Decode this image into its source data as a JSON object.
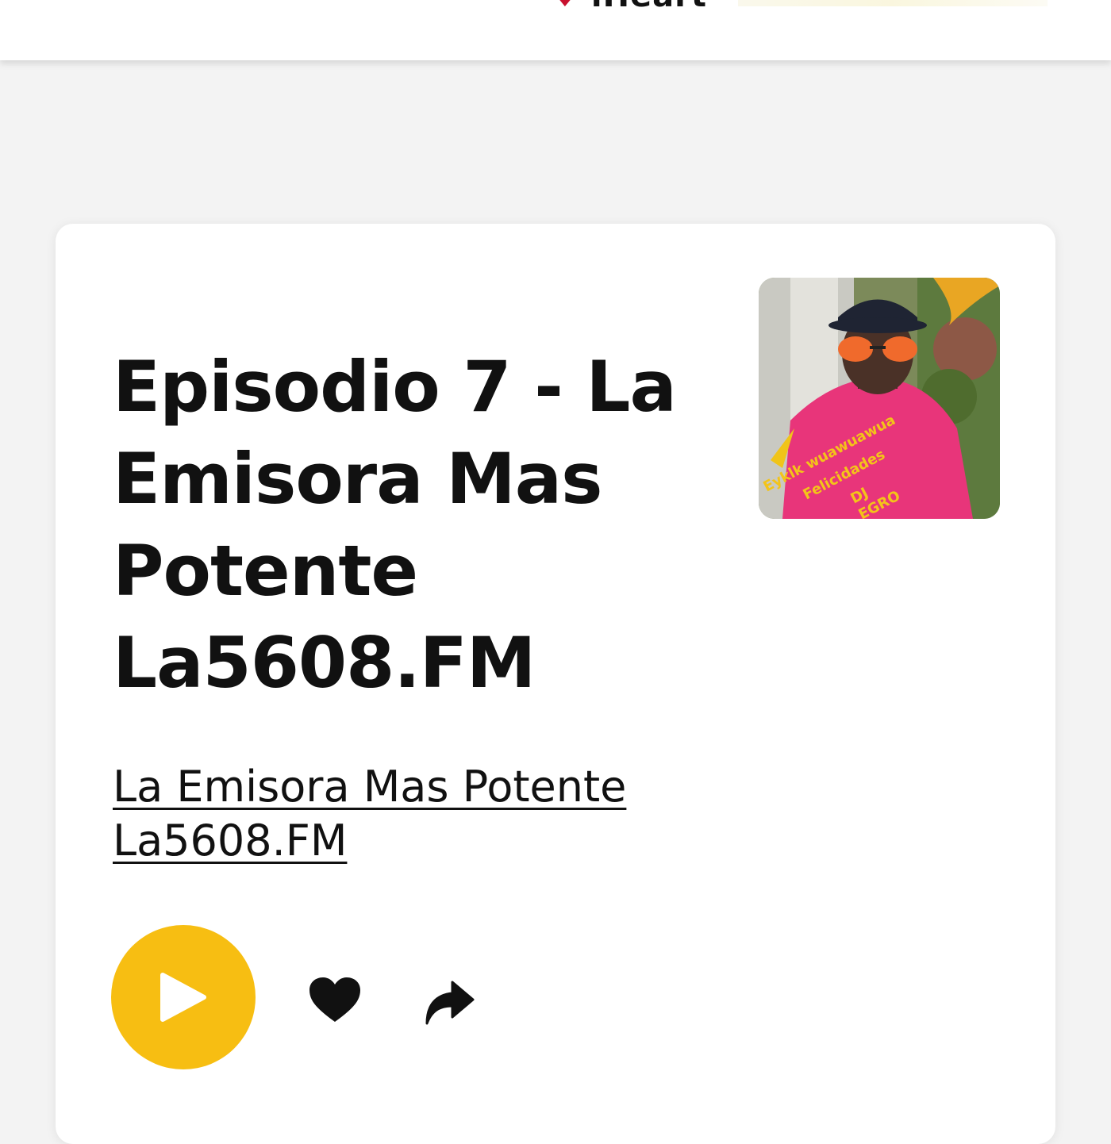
{
  "header": {
    "logo_text": "iHeart",
    "logo_icon": "heart-logo-icon"
  },
  "episode": {
    "title": "Episodio 7 - La Emisora Mas Potente La5608.FM",
    "show_name": "La Emisora Mas Potente La5608.FM",
    "cover_image_icon": "podcast-cover-image"
  },
  "controls": {
    "play_icon": "play-icon",
    "like_icon": "heart-icon",
    "share_icon": "share-icon",
    "accent_color": "#f7be12"
  }
}
